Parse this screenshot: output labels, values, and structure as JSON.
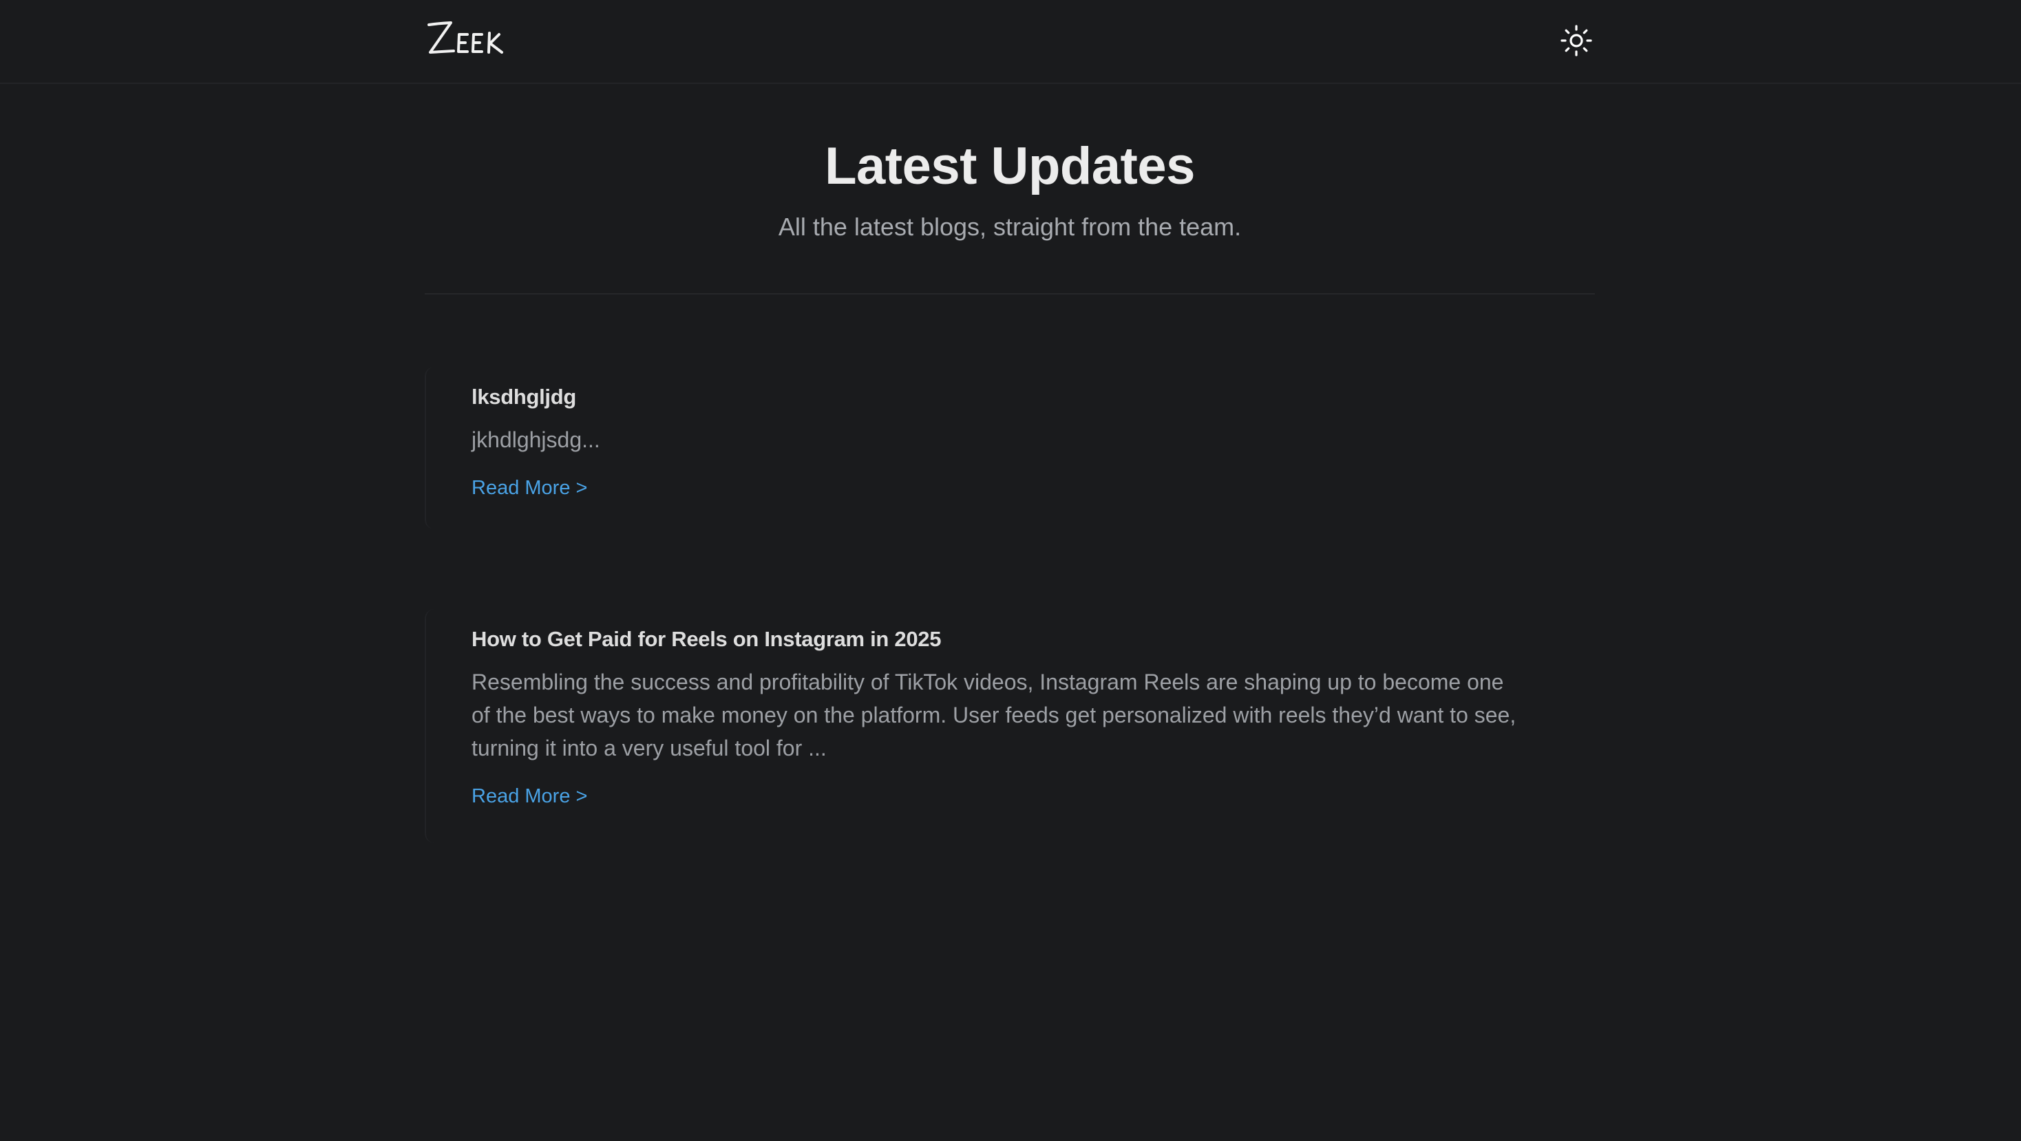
{
  "header": {
    "logo_text": "Zeek",
    "theme_toggle_icon": "sun-icon"
  },
  "hero": {
    "title": "Latest Updates",
    "subtitle": "All the latest blogs, straight from the team."
  },
  "posts": [
    {
      "title": "lksdhgljdg",
      "excerpt": "jkhdlghjsdg...",
      "read_more": "Read More >"
    },
    {
      "title": "How to Get Paid for Reels on Instagram in 2025",
      "excerpt": "Resembling the success and profitability of TikTok videos, Instagram Reels are shaping up to become one of the best ways to make money on the platform. User feeds get personalized with reels they’d want to see, turning it into a very useful tool for ...",
      "read_more": "Read More >"
    }
  ],
  "colors": {
    "background": "#1a1b1d",
    "link": "#4aa3e6",
    "title": "#ececec",
    "muted": "#a8abb0"
  }
}
